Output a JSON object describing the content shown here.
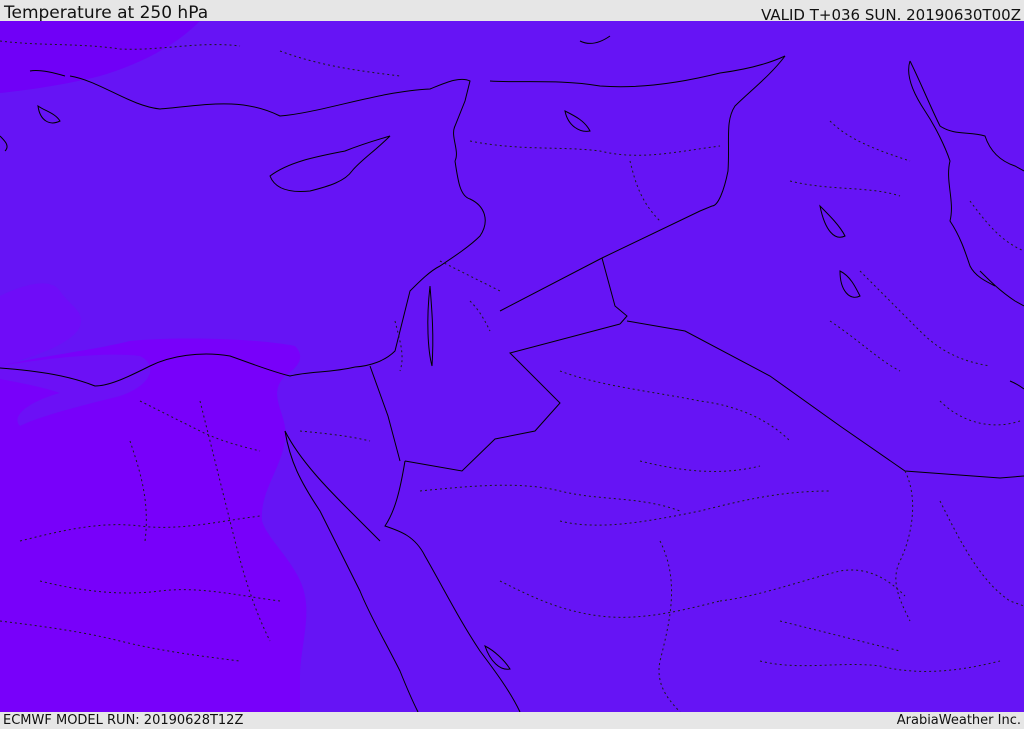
{
  "header": {
    "title": "Temperature at 250 hPa",
    "valid_time": "VALID T+036 SUN. 20190630T00Z"
  },
  "footer": {
    "model_run": "ECMWF MODEL RUN: 20190628T12Z",
    "credit": "ArabiaWeather Inc."
  },
  "map": {
    "colors": {
      "field_main": "#6614f5",
      "field_cold": "#7d00fa",
      "field_mid": "#6f0cf8",
      "coastline": "#000000",
      "borders": "#000000"
    }
  }
}
